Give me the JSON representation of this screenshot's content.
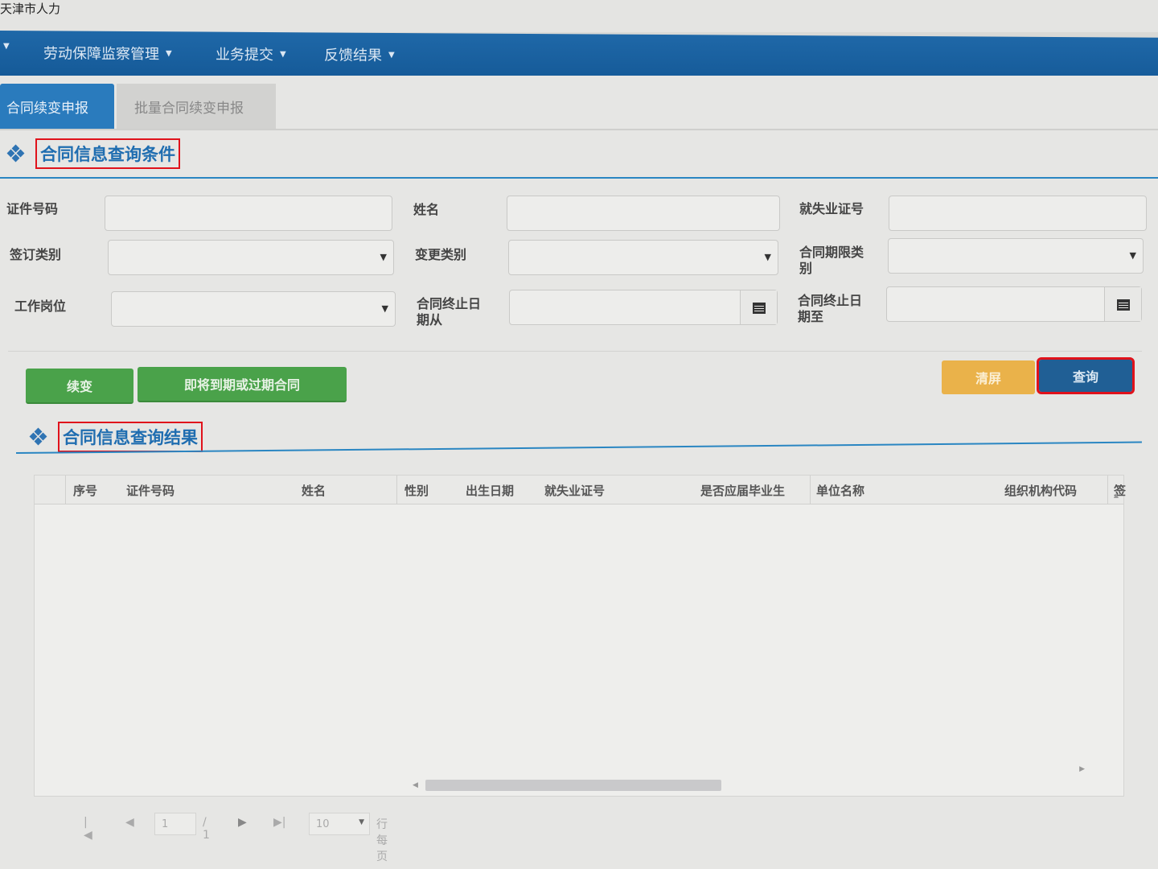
{
  "app": {
    "title": "天津市人力"
  },
  "nav": {
    "items": [
      {
        "label": "劳动保障监察管理"
      },
      {
        "label": "业务提交"
      },
      {
        "label": "反馈结果"
      }
    ]
  },
  "tabs": [
    {
      "label": "合同续变申报",
      "active": true
    },
    {
      "label": "批量合同续变申报",
      "active": false
    }
  ],
  "query": {
    "title": "合同信息查询条件",
    "fields": {
      "id_no": {
        "label": "证件号码",
        "value": ""
      },
      "name": {
        "label": "姓名",
        "value": ""
      },
      "employment_no": {
        "label": "就失业证号",
        "value": ""
      },
      "sign_type": {
        "label": "签订类别",
        "value": ""
      },
      "change_type": {
        "label": "变更类别",
        "value": ""
      },
      "term_type": {
        "label_line1": "合同期限类",
        "label_line2": "别",
        "value": ""
      },
      "position": {
        "label": "工作岗位",
        "value": ""
      },
      "end_from": {
        "label_line1": "合同终止日",
        "label_line2": "期从",
        "value": ""
      },
      "end_to": {
        "label_line1": "合同终止日",
        "label_line2": "期至",
        "value": ""
      }
    },
    "buttons": {
      "renew": "续变",
      "expiring": "即将到期或过期合同",
      "clear": "清屏",
      "search": "查询"
    }
  },
  "results": {
    "title": "合同信息查询结果",
    "columns": [
      "序号",
      "证件号码",
      "姓名",
      "性别",
      "出生日期",
      "就失业证号",
      "是否应届毕业生",
      "单位名称",
      "组织机构代码",
      "签"
    ],
    "rows": []
  },
  "pager": {
    "page": "1",
    "of_total": "/ 1",
    "page_size": "10",
    "per_page_label": "行每页"
  },
  "colors": {
    "navbar": "#1a5f9e",
    "tab_active": "#2a7bbd",
    "section_title": "#1f6db0",
    "highlight_border": "#e0121b",
    "green_button": "#4aa24a",
    "orange_button": "#eab24a",
    "blue_button": "#205f95"
  },
  "icons": {
    "section": "diamond-cluster-icon",
    "calendar": "calendar-icon",
    "dropdown": "caret-down-icon",
    "first": "first-page-icon",
    "prev": "prev-page-icon",
    "next": "next-page-icon",
    "last": "last-page-icon"
  }
}
